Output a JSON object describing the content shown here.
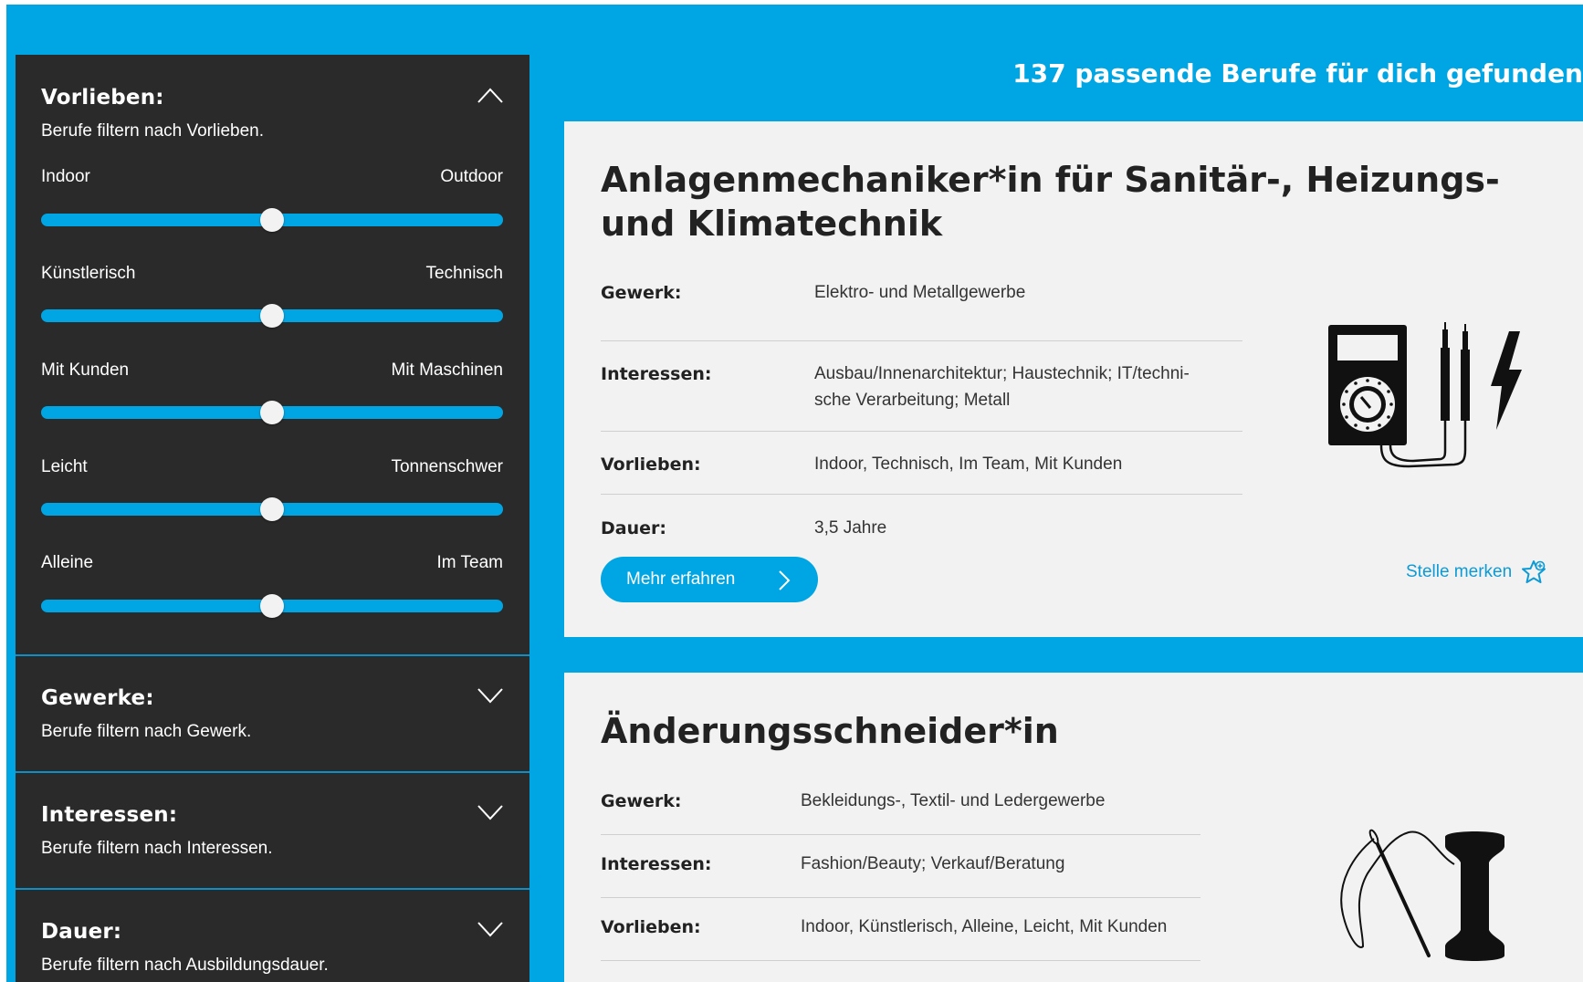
{
  "header": {
    "result_count": "137 passende Berufe für dich gefunden"
  },
  "sidebar": {
    "preferences": {
      "title": "Vorlieben:",
      "subtitle": "Berufe filtern nach Vorlieben.",
      "sliders": [
        {
          "left": "Indoor",
          "right": "Outdoor",
          "value": 0.5
        },
        {
          "left": "Künstlerisch",
          "right": "Technisch",
          "value": 0.5
        },
        {
          "left": "Mit Kunden",
          "right": "Mit Maschinen",
          "value": 0.5
        },
        {
          "left": "Leicht",
          "right": "Tonnenschwer",
          "value": 0.5
        },
        {
          "left": "Alleine",
          "right": "Im Team",
          "value": 0.5
        }
      ]
    },
    "trades": {
      "title": "Gewerke:",
      "subtitle": "Berufe filtern nach Gewerk."
    },
    "interests": {
      "title": "Interessen:",
      "subtitle": "Berufe filtern nach Interessen."
    },
    "duration": {
      "title": "Dauer:",
      "subtitle": "Berufe filtern nach Ausbildungsdauer."
    }
  },
  "jobs": [
    {
      "title": "Anlagenmechaniker*in für Sanitär-, Heizungs- und Klimatechnik",
      "labels": {
        "trade": "Gewerk:",
        "interests": "Interessen:",
        "preferences": "Vorlieben:",
        "duration": "Dauer:"
      },
      "trade": "Elektro- und Metallgewerbe",
      "interests_line1": "Ausbau/Innenarchitektur; Haustechnik; IT/techni-",
      "interests_line2": "sche Verarbeitung; Metall",
      "preferences": "Indoor, Technisch, Im Team, Mit Kunden",
      "duration": "3,5 Jahre",
      "more_label": "Mehr erfahren",
      "save_label": "Stelle merken",
      "illustration": "multimeter-icon"
    },
    {
      "title": "Änderungsschneider*in",
      "labels": {
        "trade": "Gewerk:",
        "interests": "Interessen:",
        "preferences": "Vorlieben:"
      },
      "trade": "Bekleidungs-, Textil- und Ledergewerbe",
      "interests": "Fashion/Beauty; Verkauf/Beratung",
      "preferences": "Indoor, Künstlerisch, Alleine, Leicht, Mit Kunden",
      "illustration": "needle-thread-icon"
    }
  ]
}
